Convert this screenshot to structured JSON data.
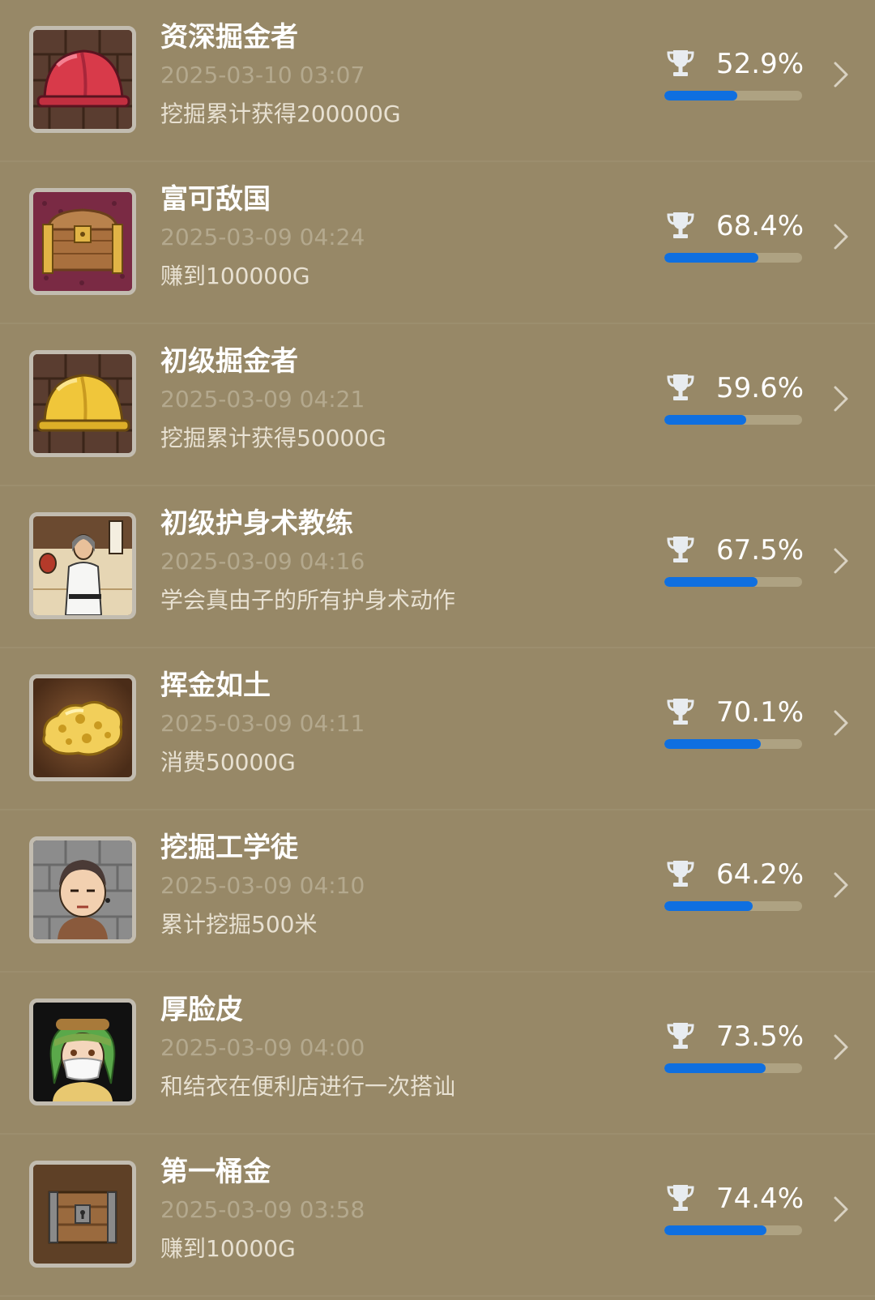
{
  "achievements": [
    {
      "title": "资深掘金者",
      "date": "2025-03-10 03:07",
      "description": "挖掘累计获得200000G",
      "percent_label": "52.9%",
      "progress": 0.529,
      "icon": "red-helmet-icon"
    },
    {
      "title": "富可敌国",
      "date": "2025-03-09 04:24",
      "description": "赚到100000G",
      "percent_label": "68.4%",
      "progress": 0.684,
      "icon": "treasure-chest-icon"
    },
    {
      "title": "初级掘金者",
      "date": "2025-03-09 04:21",
      "description": "挖掘累计获得50000G",
      "percent_label": "59.6%",
      "progress": 0.596,
      "icon": "yellow-helmet-icon"
    },
    {
      "title": "初级护身术教练",
      "date": "2025-03-09 04:16",
      "description": "学会真由子的所有护身术动作",
      "percent_label": "67.5%",
      "progress": 0.675,
      "icon": "karate-coach-icon"
    },
    {
      "title": "挥金如土",
      "date": "2025-03-09 04:11",
      "description": "消费50000G",
      "percent_label": "70.1%",
      "progress": 0.701,
      "icon": "gold-nugget-icon"
    },
    {
      "title": "挖掘工学徒",
      "date": "2025-03-09 04:10",
      "description": "累计挖掘500米",
      "percent_label": "64.2%",
      "progress": 0.642,
      "icon": "apprentice-face-icon"
    },
    {
      "title": "厚脸皮",
      "date": "2025-03-09 04:00",
      "description": "和结衣在便利店进行一次搭讪",
      "percent_label": "73.5%",
      "progress": 0.735,
      "icon": "masked-girl-icon"
    },
    {
      "title": "第一桶金",
      "date": "2025-03-09 03:58",
      "description": "赚到10000G",
      "percent_label": "74.4%",
      "progress": 0.744,
      "icon": "wooden-chest-icon"
    }
  ],
  "colors": {
    "background": "#978867",
    "progress_fill": "#0f6fe0",
    "progress_track": "#aea282",
    "date_text": "#b4a98e"
  }
}
